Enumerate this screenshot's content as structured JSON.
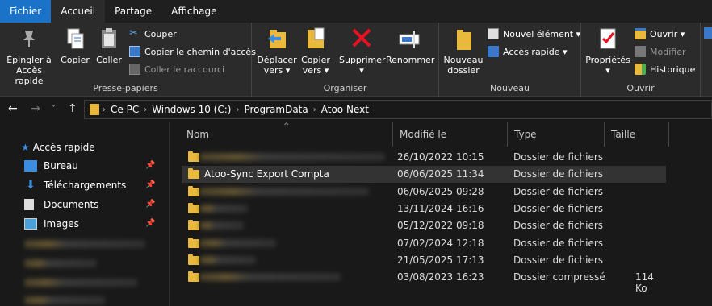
{
  "menu": {
    "tabs": [
      "Fichier",
      "Accueil",
      "Partage",
      "Affichage"
    ]
  },
  "ribbon": {
    "clipboard": {
      "label": "Presse-papiers",
      "pin": [
        "Épingler à",
        "Accès rapide"
      ],
      "copy": "Copier",
      "paste": "Coller",
      "cut": "Couper",
      "copy_path": "Copier le chemin d'accès",
      "paste_shortcut": "Coller le raccourci"
    },
    "organize": {
      "label": "Organiser",
      "move": [
        "Déplacer",
        "vers"
      ],
      "copy_to": [
        "Copier",
        "vers"
      ],
      "delete": "Supprimer",
      "rename": "Renommer"
    },
    "new": {
      "label": "Nouveau",
      "new_folder": [
        "Nouveau",
        "dossier"
      ],
      "new_item": "Nouvel élément",
      "quick_access": "Accès rapide"
    },
    "open": {
      "label": "Ouvrir",
      "properties": "Propriétés",
      "open": "Ouvrir",
      "edit": "Modifier",
      "history": "Historique"
    }
  },
  "address": {
    "crumbs": [
      "Ce PC",
      "Windows 10 (C:)",
      "ProgramData",
      "Atoo Next"
    ]
  },
  "nav": {
    "quick_access": "Accès rapide",
    "items": [
      "Bureau",
      "Téléchargements",
      "Documents",
      "Images"
    ]
  },
  "columns": [
    "Nom",
    "Modifié le",
    "Type",
    "Taille"
  ],
  "rows": [
    {
      "name": "",
      "date": "26/10/2022 10:15",
      "type": "Dossier de fichiers",
      "size": ""
    },
    {
      "name": "Atoo-Sync Export Compta",
      "date": "06/06/2025 11:34",
      "type": "Dossier de fichiers",
      "size": ""
    },
    {
      "name": "",
      "date": "06/06/2025 09:28",
      "type": "Dossier de fichiers",
      "size": ""
    },
    {
      "name": "",
      "date": "13/11/2024 16:16",
      "type": "Dossier de fichiers",
      "size": ""
    },
    {
      "name": "",
      "date": "05/12/2022 09:18",
      "type": "Dossier de fichiers",
      "size": ""
    },
    {
      "name": "",
      "date": "07/02/2024 12:18",
      "type": "Dossier de fichiers",
      "size": ""
    },
    {
      "name": "",
      "date": "21/05/2025 17:13",
      "type": "Dossier de fichiers",
      "size": ""
    },
    {
      "name": "",
      "date": "03/08/2023 16:23",
      "type": "Dossier compressé",
      "size": "114 Ko"
    }
  ],
  "colors": {
    "accent": "#1a73c9",
    "folder": "#e8b93d",
    "delete_red": "#e81123"
  }
}
